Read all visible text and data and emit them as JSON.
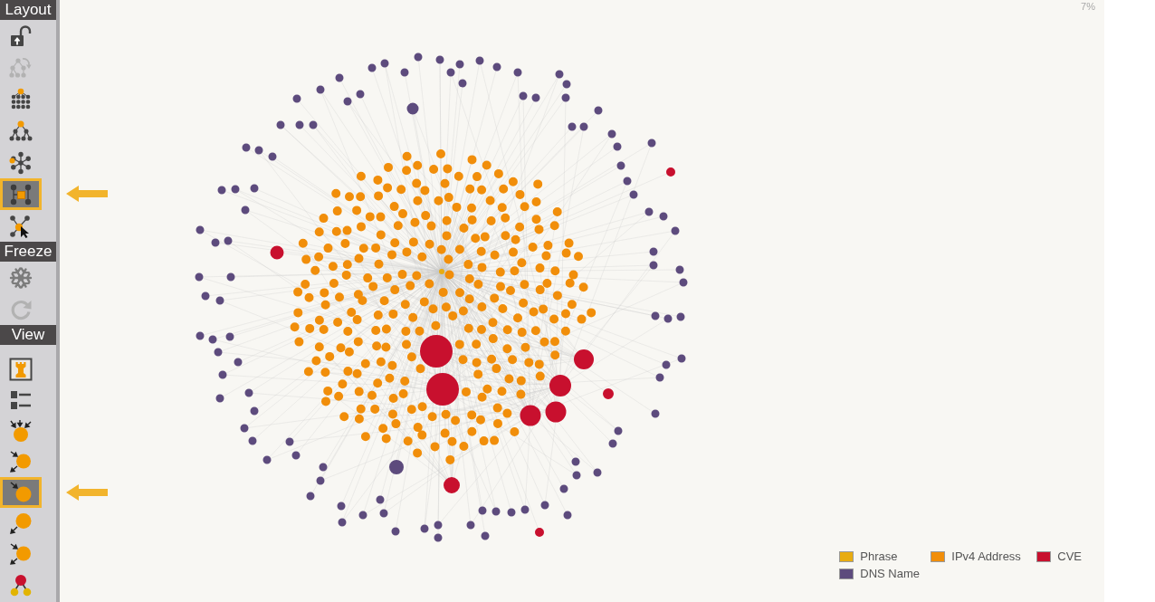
{
  "toolbar": {
    "sections": [
      {
        "title": "Layout",
        "items": [
          {
            "kind": "unlock",
            "selected": false,
            "disabled": false
          },
          {
            "kind": "tree-rotate",
            "selected": false,
            "disabled": true
          },
          {
            "kind": "hierarchy-dense",
            "selected": false,
            "disabled": false
          },
          {
            "kind": "hierarchy",
            "selected": false,
            "disabled": false
          },
          {
            "kind": "radial",
            "selected": false,
            "disabled": false
          },
          {
            "kind": "node-grid",
            "selected": true,
            "disabled": false
          },
          {
            "kind": "node-cursor",
            "selected": false,
            "disabled": false
          }
        ]
      },
      {
        "title": "Freeze",
        "items": [
          {
            "kind": "snowflake",
            "selected": false,
            "disabled": false
          },
          {
            "kind": "refresh",
            "selected": false,
            "disabled": true
          }
        ]
      },
      {
        "title": "View",
        "items": [
          {
            "kind": "rook-frame",
            "selected": false,
            "disabled": false
          },
          {
            "kind": "list",
            "selected": false,
            "disabled": false
          },
          {
            "kind": "node-arrows-in",
            "selected": false,
            "disabled": false
          },
          {
            "kind": "node-in-out",
            "selected": false,
            "disabled": false
          },
          {
            "kind": "node-in",
            "selected": true,
            "disabled": false
          },
          {
            "kind": "node-out",
            "selected": false,
            "disabled": false
          },
          {
            "kind": "node-in-out",
            "selected": false,
            "disabled": false
          },
          {
            "kind": "node-children",
            "selected": false,
            "disabled": false
          }
        ]
      }
    ]
  },
  "canvas": {
    "percentage": "7%",
    "legend": [
      {
        "label": "Phrase",
        "color": "#e8ac10"
      },
      {
        "label": "IPv4 Address",
        "color": "#f18e0a"
      },
      {
        "label": "CVE",
        "color": "#c8102e"
      },
      {
        "label": "DNS Name",
        "color": "#5d4b7d"
      }
    ]
  }
}
